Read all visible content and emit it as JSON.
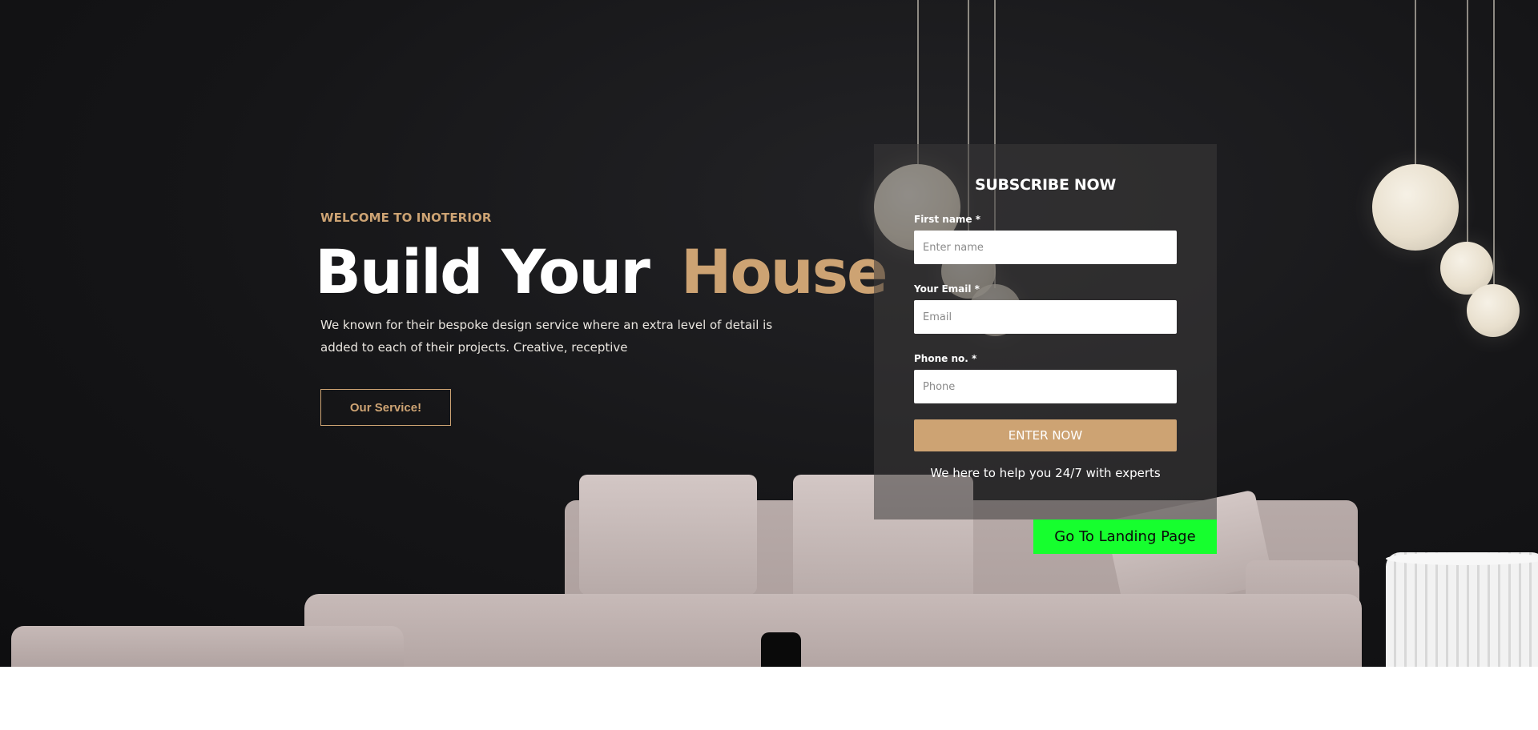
{
  "hero": {
    "eyebrow": "WELCOME TO INOTERIOR",
    "headline_white": "Build Your",
    "headline_accent": "House",
    "description": "We known for their bespoke design service where an extra level of detail is added to each of their projects. Creative, receptive",
    "service_button": "Our Service!"
  },
  "subscribe": {
    "title": "SUBSCRIBE NOW",
    "first_name_label": "First name *",
    "first_name_placeholder": "Enter name",
    "email_label": "Your Email *",
    "email_placeholder": "Email",
    "phone_label": "Phone no. *",
    "phone_placeholder": "Phone",
    "submit_label": "ENTER NOW",
    "help_text": "We here to help you 24/7 with experts"
  },
  "landing_button": "Go To Landing Page",
  "colors": {
    "accent": "#cda373",
    "landing_button": "#16ff2e",
    "hero_background": "#151517"
  }
}
